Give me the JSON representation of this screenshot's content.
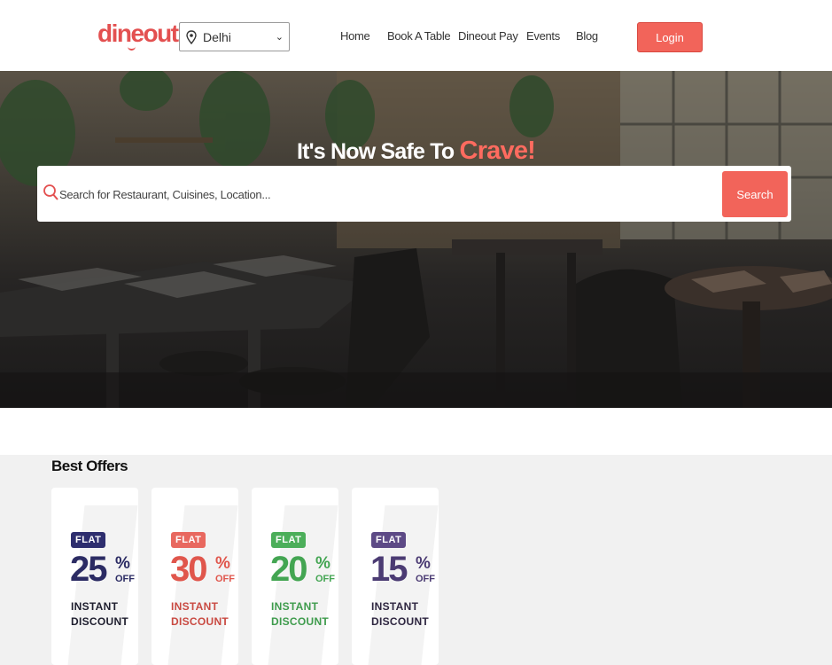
{
  "header": {
    "logo_text": "dineout",
    "city": {
      "value": "Delhi",
      "icon": "location-pin-icon"
    },
    "nav": [
      {
        "label": "Home"
      },
      {
        "label": "Book A Table"
      },
      {
        "label": "Dineout Pay"
      },
      {
        "label": "Events"
      },
      {
        "label": "Blog"
      }
    ],
    "login_label": "Login"
  },
  "hero": {
    "title_prefix": "It's Now Safe To",
    "title_accent": "Crave!",
    "search": {
      "placeholder": "Search for Restaurant, Cuisines, Location...",
      "value": "",
      "button_label": "Search"
    }
  },
  "offers": {
    "title": "Best Offers",
    "cards": [
      {
        "badge": "FLAT",
        "percent": "25",
        "sign": "%",
        "off": "OFF",
        "line1": "INSTANT",
        "line2": "DISCOUNT",
        "badge_color": "#2e2e6e",
        "number_color": "#2b2b63",
        "text_color": "#1e1e2e"
      },
      {
        "badge": "FLAT",
        "percent": "30",
        "sign": "%",
        "off": "OFF",
        "line1": "INSTANT",
        "line2": "DISCOUNT",
        "badge_color": "#e8685f",
        "number_color": "#e0564c",
        "text_color": "#c94a42"
      },
      {
        "badge": "FLAT",
        "percent": "20",
        "sign": "%",
        "off": "OFF",
        "line1": "INSTANT",
        "line2": "DISCOUNT",
        "badge_color": "#4cae5a",
        "number_color": "#43a552",
        "text_color": "#3e9b4c"
      },
      {
        "badge": "FLAT",
        "percent": "15",
        "sign": "%",
        "off": "OFF",
        "line1": "INSTANT",
        "line2": "DISCOUNT",
        "badge_color": "#5d4a86",
        "number_color": "#4b3b73",
        "text_color": "#2e2640"
      }
    ]
  },
  "colors": {
    "brand": "#e35050",
    "button": "#f2645a"
  }
}
